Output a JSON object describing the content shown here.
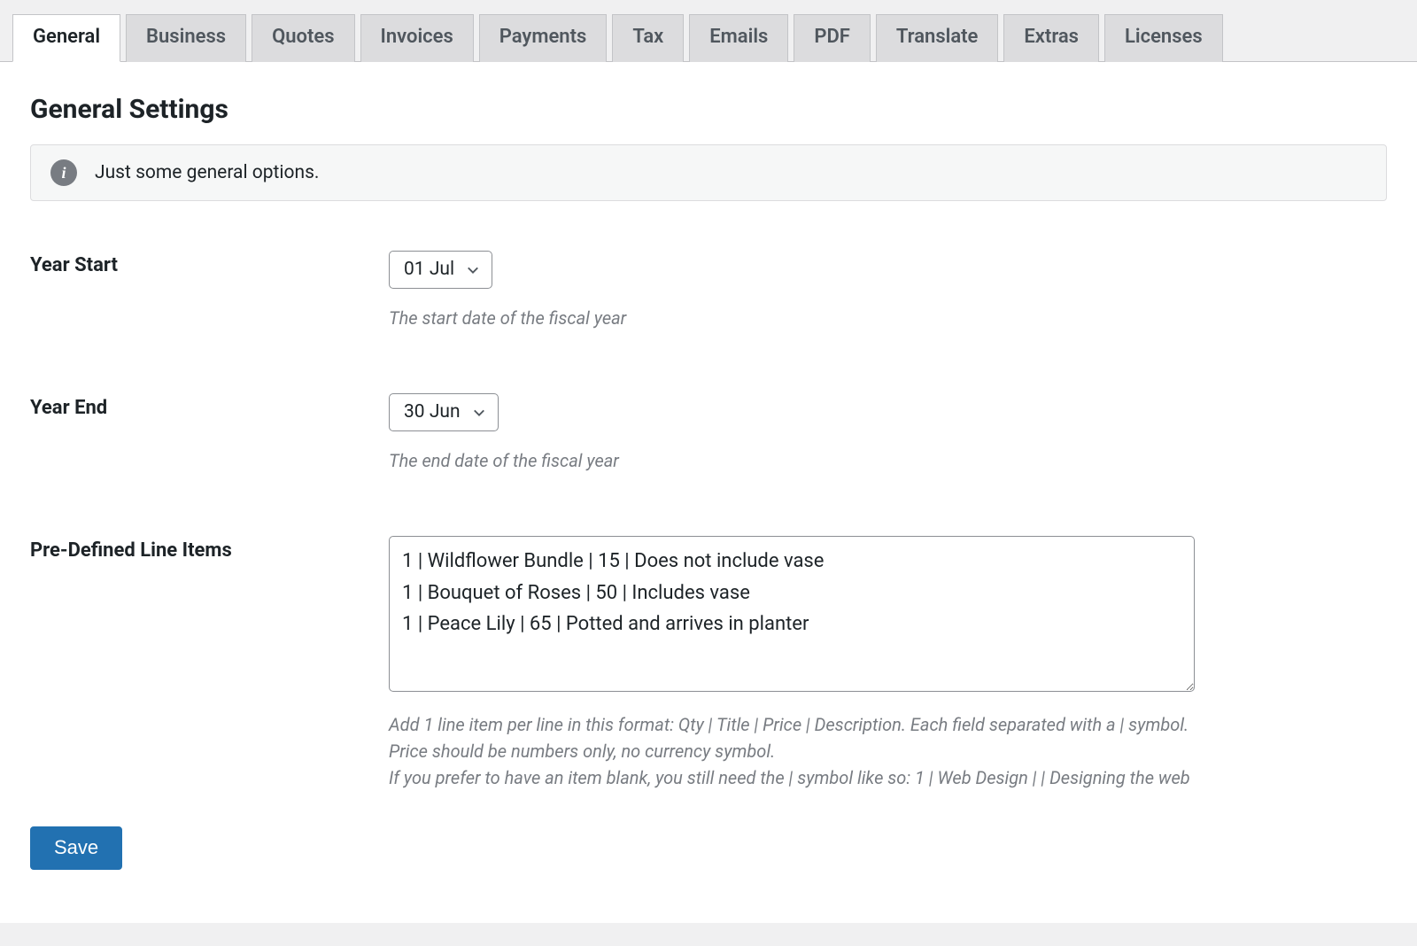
{
  "tabs": [
    {
      "label": "General",
      "active": true
    },
    {
      "label": "Business",
      "active": false
    },
    {
      "label": "Quotes",
      "active": false
    },
    {
      "label": "Invoices",
      "active": false
    },
    {
      "label": "Payments",
      "active": false
    },
    {
      "label": "Tax",
      "active": false
    },
    {
      "label": "Emails",
      "active": false
    },
    {
      "label": "PDF",
      "active": false
    },
    {
      "label": "Translate",
      "active": false
    },
    {
      "label": "Extras",
      "active": false
    },
    {
      "label": "Licenses",
      "active": false
    }
  ],
  "page": {
    "title": "General Settings"
  },
  "notice": {
    "icon_glyph": "i",
    "text": "Just some general options."
  },
  "fields": {
    "year_start": {
      "label": "Year Start",
      "value": "01 Jul",
      "description": "The start date of the fiscal year"
    },
    "year_end": {
      "label": "Year End",
      "value": "30 Jun",
      "description": "The end date of the fiscal year"
    },
    "line_items": {
      "label": "Pre-Defined Line Items",
      "value": "1 | Wildflower Bundle | 15 | Does not include vase\n1 | Bouquet of Roses | 50 | Includes vase\n1 | Peace Lily | 65 | Potted and arrives in planter",
      "description_lines": [
        "Add 1 line item per line in this format: Qty | Title | Price | Description. Each field separated with a | symbol.",
        "Price should be numbers only, no currency symbol.",
        "If you prefer to have an item blank, you still need the | symbol like so: 1 | Web Design | | Designing the web"
      ]
    }
  },
  "actions": {
    "save_label": "Save"
  }
}
